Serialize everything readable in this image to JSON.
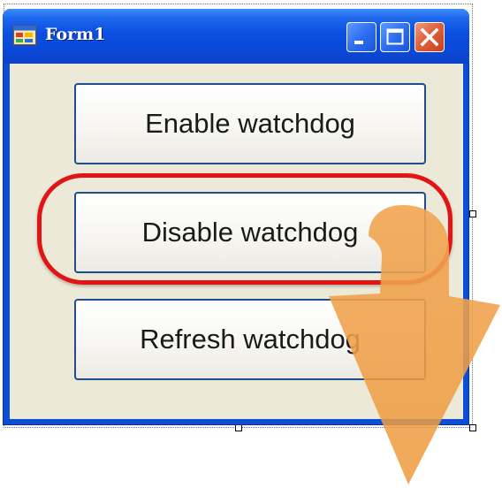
{
  "window": {
    "title": "Form1",
    "colors": {
      "titlebar": "#0b4fe0",
      "client_background": "#ece9d8",
      "close_button": "#e0623e"
    }
  },
  "buttons": {
    "enable_label": "Enable watchdog",
    "disable_label": "Disable watchdog",
    "refresh_label": "Refresh watchdog"
  },
  "annotations": {
    "highlight_color": "#e11515",
    "arrow_color": "#f0a040",
    "highlighted_item": "Disable watchdog"
  },
  "icons": [
    "app-form-icon",
    "minimize-icon",
    "maximize-icon",
    "close-icon",
    "down-arrow-icon"
  ]
}
